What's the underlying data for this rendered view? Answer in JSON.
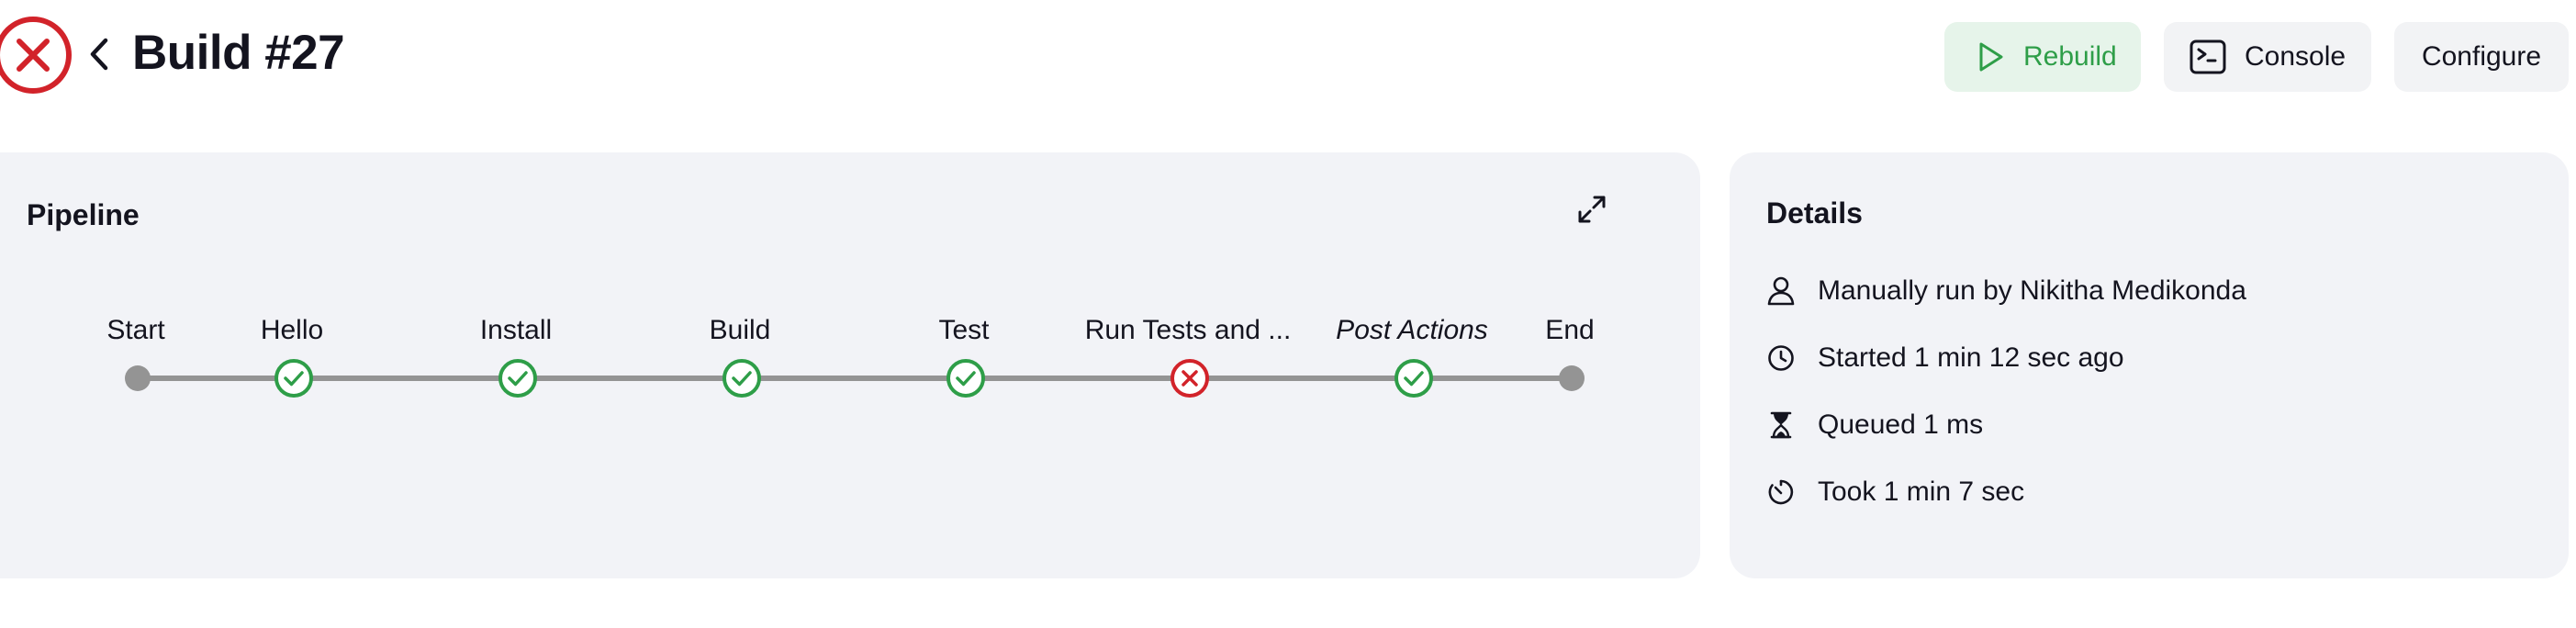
{
  "header": {
    "title": "Build #27",
    "status": "failed",
    "buttons": {
      "rebuild": "Rebuild",
      "console": "Console",
      "configure": "Configure"
    }
  },
  "pipeline": {
    "title": "Pipeline",
    "stages": [
      {
        "label": "Start",
        "status": "start"
      },
      {
        "label": "Hello",
        "status": "success"
      },
      {
        "label": "Install",
        "status": "success"
      },
      {
        "label": "Build",
        "status": "success"
      },
      {
        "label": "Test",
        "status": "success"
      },
      {
        "label": "Run Tests and ...",
        "status": "failed"
      },
      {
        "label": "Post Actions",
        "status": "success"
      },
      {
        "label": "End",
        "status": "end"
      }
    ]
  },
  "details": {
    "title": "Details",
    "items": [
      {
        "icon": "user-icon",
        "text": "Manually run by Nikitha Medikonda"
      },
      {
        "icon": "clock-icon",
        "text": "Started 1 min 12 sec ago"
      },
      {
        "icon": "hourglass-icon",
        "text": "Queued 1 ms"
      },
      {
        "icon": "timer-icon",
        "text": "Took 1 min 7 sec"
      }
    ]
  },
  "colors": {
    "success": "#2e9e48",
    "failed": "#d2232a",
    "neutral": "#949494",
    "card_bg": "#f2f3f7",
    "rebuild_bg": "#e6f4ea"
  }
}
